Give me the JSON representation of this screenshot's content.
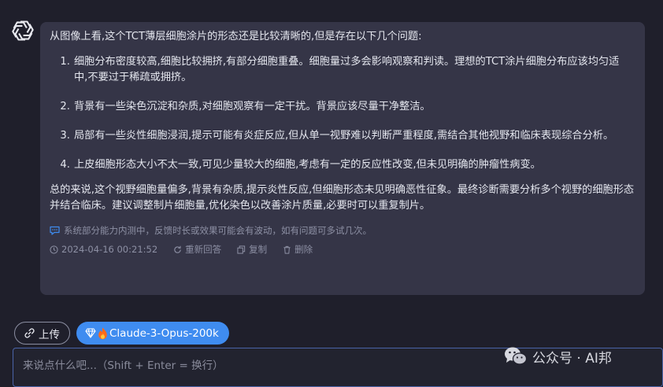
{
  "message": {
    "intro": "从图像上看,这个TCT薄层细胞涂片的形态还是比较清晰的,但是存在以下几个问题:",
    "issues": [
      {
        "num": "1.",
        "text": "细胞分布密度较高,细胞比较拥挤,有部分细胞重叠。细胞量过多会影响观察和判读。理想的TCT涂片细胞分布应该均匀适中,不要过于稀疏或拥挤。"
      },
      {
        "num": "2.",
        "text": "背景有一些染色沉淀和杂质,对细胞观察有一定干扰。背景应该尽量干净整洁。"
      },
      {
        "num": "3.",
        "text": "局部有一些炎性细胞浸润,提示可能有炎症反应,但从单一视野难以判断严重程度,需结合其他视野和临床表现综合分析。"
      },
      {
        "num": "4.",
        "text": "上皮细胞形态大小不太一致,可见少量较大的细胞,考虑有一定的反应性改变,但未见明确的肿瘤性病变。"
      }
    ],
    "summary": "总的来说,这个视野细胞量偏多,背景有杂质,提示炎性反应,但细胞形态未见明确恶性征象。最终诊断需要分析多个视野的细胞形态并结合临床。建议调整制片细胞量,优化染色以改善涂片质量,必要时可以重复制片。",
    "notice": "系统部分能力内测中，反馈时长或效果可能会有波动，如有问题可多试几次。",
    "timestamp": "2024-04-16 00:21:52",
    "regenerate_label": "重新回答",
    "copy_label": "复制",
    "delete_label": "删除"
  },
  "toolbar": {
    "upload_label": "上传",
    "model_label": "Claude-3-Opus-200k"
  },
  "composer": {
    "placeholder": "来说点什么吧...（Shift + Enter = 换行）",
    "value": ""
  },
  "watermark": {
    "text": "公众号 · AI邦"
  },
  "icons": {
    "avatar": "openai-logo-icon",
    "notice": "chat-bubble-icon",
    "time": "clock-icon",
    "regenerate": "refresh-icon",
    "copy": "copy-icon",
    "delete": "trash-icon",
    "upload": "link-icon",
    "model": "diamond-icon",
    "fire": "fire-icon"
  },
  "colors": {
    "background": "#1f1f2b",
    "bubble": "#353547",
    "accent": "#3f8cf0",
    "muted": "#8d90a4"
  }
}
